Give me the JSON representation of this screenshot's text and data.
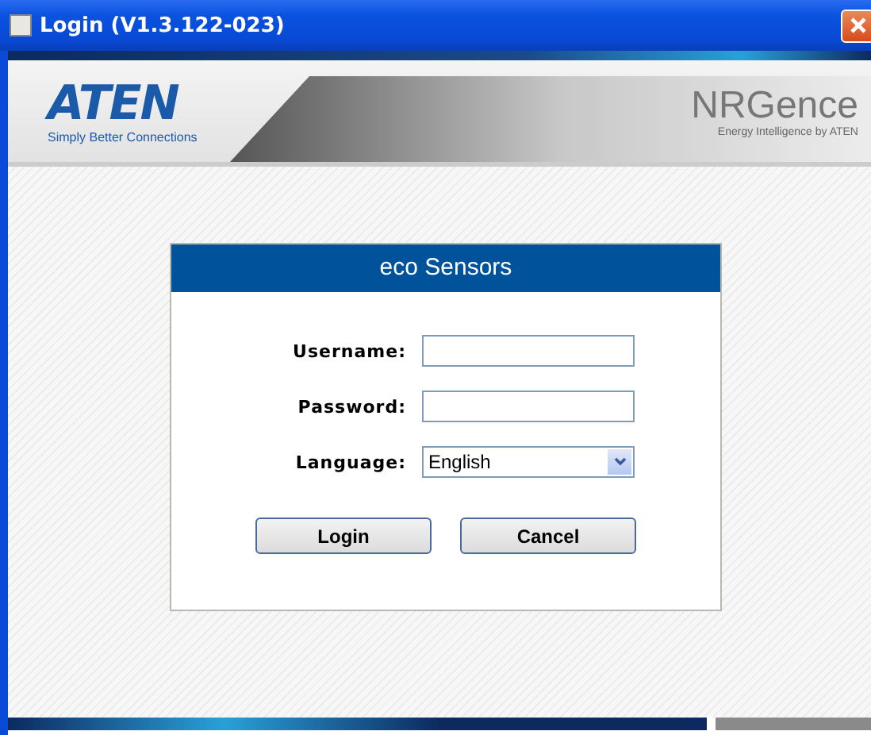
{
  "window": {
    "title": "Login (V1.3.122-023)"
  },
  "header": {
    "brand_left": {
      "name": "ATEN",
      "tagline": "Simply Better Connections"
    },
    "brand_right": {
      "name": "NRGence",
      "tagline": "Energy Intelligence by ATEN"
    }
  },
  "dialog": {
    "title": "eco Sensors",
    "fields": [
      {
        "label": "Username:",
        "kind": "text"
      },
      {
        "label": "Password:",
        "kind": "password"
      },
      {
        "label": "Language:",
        "kind": "select",
        "value": "English"
      }
    ],
    "buttons": [
      "Login",
      "Cancel"
    ]
  }
}
